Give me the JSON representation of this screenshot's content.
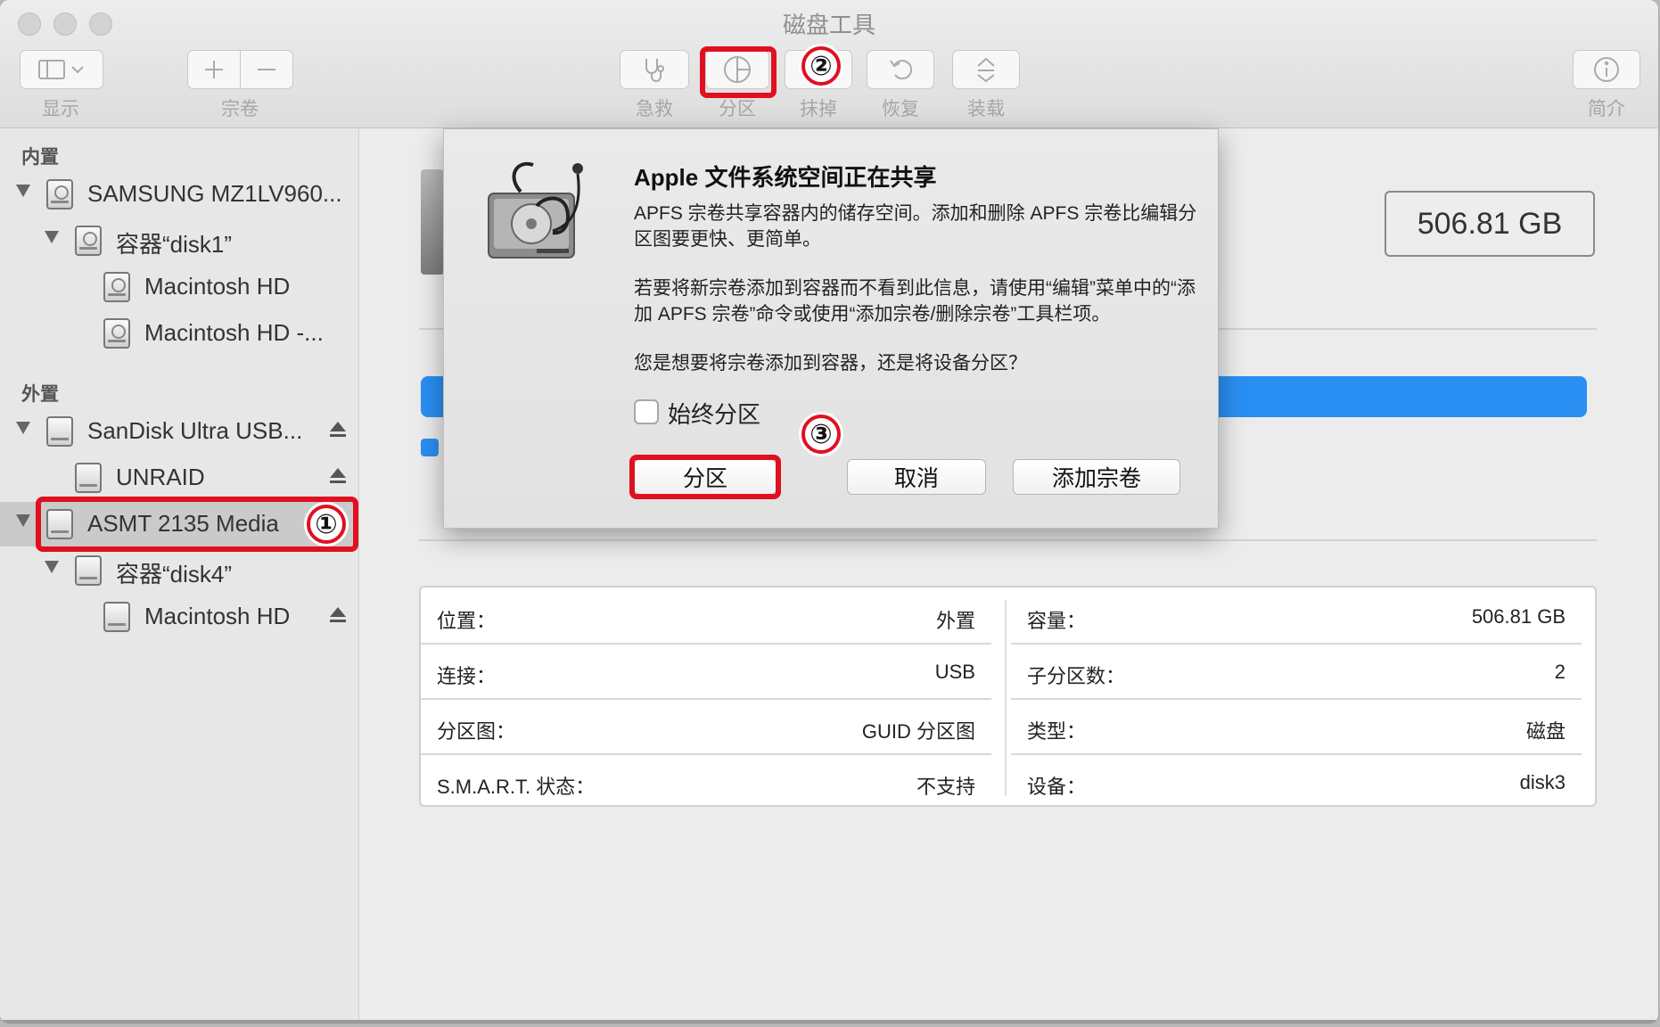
{
  "window": {
    "title": "磁盘工具"
  },
  "toolbar": {
    "view_label": "显示",
    "volume_label": "宗卷",
    "firstaid_label": "急救",
    "partition_label": "分区",
    "erase_label": "抹掉",
    "restore_label": "恢复",
    "mount_label": "装载",
    "info_label": "简介"
  },
  "annotations": {
    "step1": "①",
    "step2": "②",
    "step3": "③",
    "accent_color": "#e01020"
  },
  "sidebar": {
    "internal_header": "内置",
    "external_header": "外置",
    "internal_items": [
      {
        "label": "SAMSUNG MZ1LV960..."
      },
      {
        "label": "容器“disk1”"
      },
      {
        "label": "Macintosh HD"
      },
      {
        "label": "Macintosh HD -..."
      }
    ],
    "external_items": [
      {
        "label": "SanDisk Ultra USB..."
      },
      {
        "label": "UNRAID"
      },
      {
        "label": "ASMT 2135 Media"
      },
      {
        "label": "容器“disk4”"
      },
      {
        "label": "Macintosh HD"
      }
    ]
  },
  "main": {
    "capacity_display": "506.81 GB",
    "usage_color": "#2a8ff2",
    "info_left": [
      {
        "key": "位置：",
        "value": "外置"
      },
      {
        "key": "连接：",
        "value": "USB"
      },
      {
        "key": "分区图：",
        "value": "GUID 分区图"
      },
      {
        "key": "S.M.A.R.T. 状态：",
        "value": "不支持"
      }
    ],
    "info_right": [
      {
        "key": "容量：",
        "value": "506.81 GB"
      },
      {
        "key": "子分区数：",
        "value": "2"
      },
      {
        "key": "类型：",
        "value": "磁盘"
      },
      {
        "key": "设备：",
        "value": "disk3"
      }
    ]
  },
  "dialog": {
    "title": "Apple 文件系统空间正在共享",
    "para1": "APFS 宗卷共享容器内的储存空间。添加和删除 APFS 宗卷比编辑分区图要更快、更简单。",
    "para2": "若要将新宗卷添加到容器而不看到此信息，请使用“编辑”菜单中的“添加 APFS 宗卷”命令或使用“添加宗卷/删除宗卷”工具栏项。",
    "para3": "您是想要将宗卷添加到容器，还是将设备分区？",
    "checkbox_label": "始终分区",
    "btn_partition": "分区",
    "btn_cancel": "取消",
    "btn_add_volume": "添加宗卷"
  }
}
